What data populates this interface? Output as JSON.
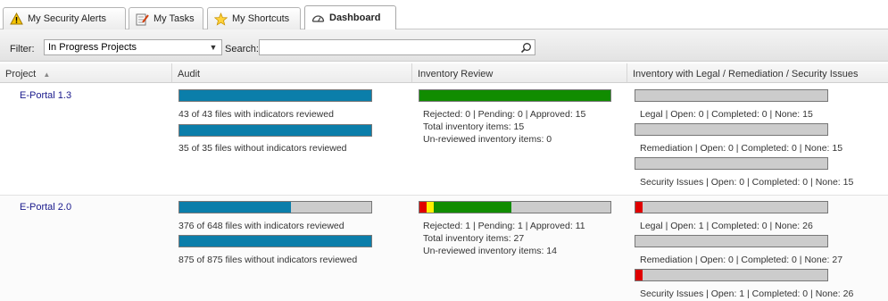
{
  "tabs": [
    {
      "label": "My Security Alerts",
      "icon": "warning-icon"
    },
    {
      "label": "My Tasks",
      "icon": "tasks-icon"
    },
    {
      "label": "My Shortcuts",
      "icon": "star-icon"
    },
    {
      "label": "Dashboard",
      "icon": "dashboard-icon",
      "active": true
    }
  ],
  "filter": {
    "label": "Filter:",
    "value": "In Progress Projects",
    "search_label": "Search:",
    "search_value": ""
  },
  "columns": {
    "project": "Project",
    "audit": "Audit",
    "inventory": "Inventory Review",
    "issues": "Inventory with Legal / Remediation / Security Issues"
  },
  "colors": {
    "audit_fill": "#0b7eaa",
    "approved": "#118c00",
    "rejected": "#e00000",
    "pending": "#ffee00",
    "empty": "#cccccc"
  },
  "rows": [
    {
      "project": "E-Portal 1.3",
      "audit": [
        {
          "fraction": 1.0,
          "text": "43 of 43 files with indicators reviewed"
        },
        {
          "fraction": 1.0,
          "text": "35 of 35 files without indicators reviewed"
        }
      ],
      "inventory": {
        "rejected": 0,
        "pending": 0,
        "approved": 15,
        "total_items": 15,
        "line1": "Rejected: 0  |  Pending: 0  |  Approved: 15",
        "line2": "Total inventory items: 15",
        "line3": "Un-reviewed inventory items: 0"
      },
      "issues": [
        {
          "fraction_open": 0.0,
          "text": "Legal  |  Open: 0  |  Completed: 0  |  None: 15"
        },
        {
          "fraction_open": 0.0,
          "text": "Remediation  |  Open: 0  |  Completed: 0  |  None: 15"
        },
        {
          "fraction_open": 0.0,
          "text": "Security Issues  |  Open: 0  |  Completed: 0  |  None: 15"
        }
      ]
    },
    {
      "project": "E-Portal 2.0",
      "audit": [
        {
          "fraction": 0.5802,
          "text": "376 of 648 files with indicators reviewed"
        },
        {
          "fraction": 1.0,
          "text": "875 of 875 files without indicators reviewed"
        }
      ],
      "inventory": {
        "rejected": 1,
        "pending": 1,
        "approved": 11,
        "total_items": 27,
        "line1": "Rejected: 1  |  Pending: 1  |  Approved: 11",
        "line2": "Total inventory items: 27",
        "line3": "Un-reviewed inventory items: 14"
      },
      "issues": [
        {
          "fraction_open": 0.037,
          "text": "Legal  |  Open: 1  |  Completed: 0  |  None: 26"
        },
        {
          "fraction_open": 0.0,
          "text": "Remediation  |  Open: 0  |  Completed: 0  |  None: 27"
        },
        {
          "fraction_open": 0.037,
          "text": "Security Issues  |  Open: 1  |  Completed: 0  |  None: 26"
        }
      ]
    }
  ]
}
